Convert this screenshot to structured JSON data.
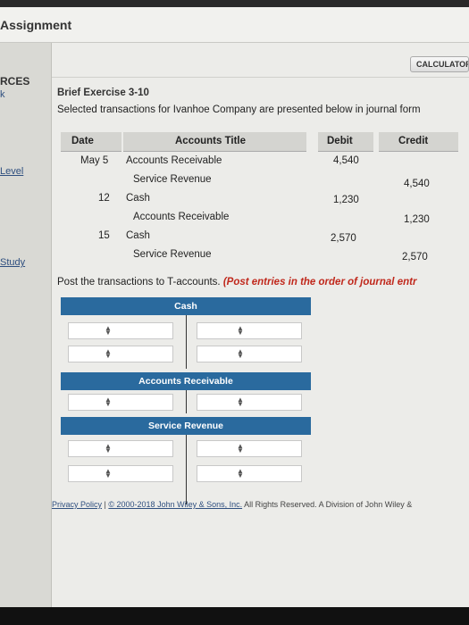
{
  "header": {
    "title": "Assignment"
  },
  "left_panel": {
    "heading": "RCES",
    "items": [
      {
        "label": "k"
      },
      {
        "label": "Level"
      },
      {
        "label": "Study"
      }
    ]
  },
  "toolbar": {
    "calculator_label": "CALCULATOR"
  },
  "exercise": {
    "title": "Brief Exercise 3-10",
    "description": "Selected transactions for Ivanhoe Company are presented below in journal form"
  },
  "journal": {
    "headers": {
      "date": "Date",
      "account": "Accounts Title",
      "debit": "Debit",
      "credit": "Credit"
    },
    "rows": [
      {
        "date": "May 5",
        "account": "Accounts Receivable",
        "debit": "4,540",
        "credit": ""
      },
      {
        "date": "",
        "account": "Service Revenue",
        "debit": "",
        "credit": "4,540"
      },
      {
        "date": "12",
        "account": "Cash",
        "debit": "1,230",
        "credit": ""
      },
      {
        "date": "",
        "account": "Accounts Receivable",
        "debit": "",
        "credit": "1,230"
      },
      {
        "date": "15",
        "account": "Cash",
        "debit": "2,570",
        "credit": ""
      },
      {
        "date": "",
        "account": "Service Revenue",
        "debit": "",
        "credit": "2,570"
      }
    ]
  },
  "instructions": {
    "main": "Post the transactions to T-accounts.",
    "emphasis": "(Post entries in the order of journal entr"
  },
  "t_accounts": [
    {
      "name": "Cash"
    },
    {
      "name": "Accounts Receivable"
    },
    {
      "name": "Service Revenue"
    }
  ],
  "footer": {
    "privacy": "Privacy Policy",
    "separator": "|",
    "copyright": "© 2000-2018 John Wiley & Sons, Inc.",
    "rest": "All Rights Reserved. A Division of John Wiley &"
  }
}
